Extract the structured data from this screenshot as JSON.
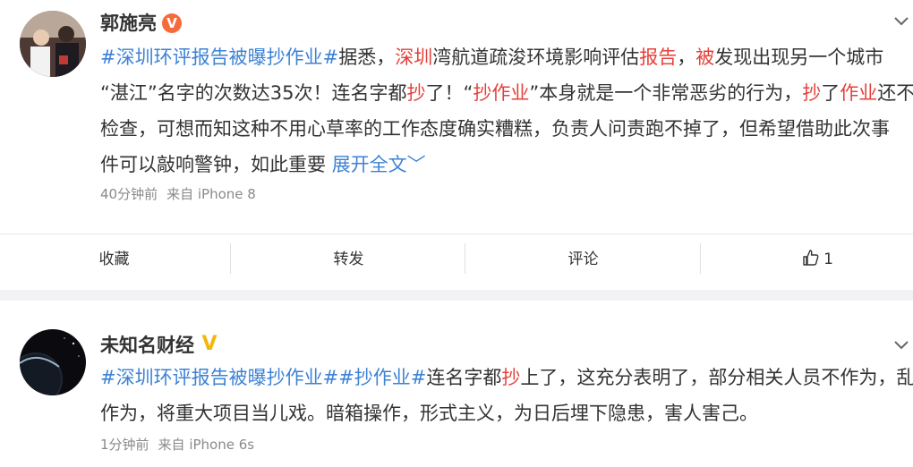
{
  "post1": {
    "author": "郭施亮",
    "verified_badge": "V",
    "menu_icon": "chevron-down-icon",
    "lines": [
      [
        {
          "t": "#深圳环评报告被曝抄作业#",
          "c": "blue"
        },
        {
          "t": "据悉，",
          "c": ""
        },
        {
          "t": "深圳",
          "c": "red"
        },
        {
          "t": "湾航道疏浚环境影响评估",
          "c": ""
        },
        {
          "t": "报告",
          "c": "red"
        },
        {
          "t": "，",
          "c": ""
        },
        {
          "t": "被",
          "c": "red"
        },
        {
          "t": "发现出现另一个城市",
          "c": ""
        }
      ],
      [
        {
          "t": "“湛江”名字的次数达35次！连名字都",
          "c": ""
        },
        {
          "t": "抄",
          "c": "red"
        },
        {
          "t": "了！“",
          "c": ""
        },
        {
          "t": "抄作业",
          "c": "red"
        },
        {
          "t": "”本身就是一个非常恶劣的行为，",
          "c": ""
        },
        {
          "t": "抄",
          "c": "red"
        },
        {
          "t": "了",
          "c": ""
        },
        {
          "t": "作业",
          "c": "red"
        },
        {
          "t": "还不",
          "c": ""
        }
      ],
      [
        {
          "t": "检查，可想而知这种不用心草率的工作态度确实糟糕，负责人问责跑不掉了，但希望借助此次事",
          "c": ""
        }
      ],
      [
        {
          "t": "件可以敲响警钟，如此重要 ",
          "c": ""
        },
        {
          "t": "展开全文﹀",
          "c": "blue"
        }
      ]
    ],
    "time": "40分钟前",
    "source": "来自 iPhone 8"
  },
  "actions": {
    "favorite": "收藏",
    "repost": "转发",
    "comment": "评论",
    "like_count": "1",
    "like_icon": "thumbs-up-icon"
  },
  "post2": {
    "author": "未知名财经",
    "verified_badge": "V",
    "menu_icon": "chevron-down-icon",
    "lines": [
      [
        {
          "t": "#深圳环评报告被曝抄作业#",
          "c": "blue"
        },
        {
          "t": "#抄作业#",
          "c": "blue"
        },
        {
          "t": "连名字都",
          "c": ""
        },
        {
          "t": "抄",
          "c": "red"
        },
        {
          "t": "上了，这充分表明了，部分相关人员不作为，乱",
          "c": ""
        }
      ],
      [
        {
          "t": "作为，将重大项目当儿戏。暗箱操作，形式主义，为日后埋下隐患，害人害己。",
          "c": ""
        }
      ]
    ],
    "time": "1分钟前",
    "source": "来自 iPhone 6s"
  },
  "colors": {
    "link_blue": "#3c82d6",
    "highlight_red": "#e5403a",
    "badge_orange": "#f76b3a",
    "badge_gold": "#f5b60c"
  }
}
